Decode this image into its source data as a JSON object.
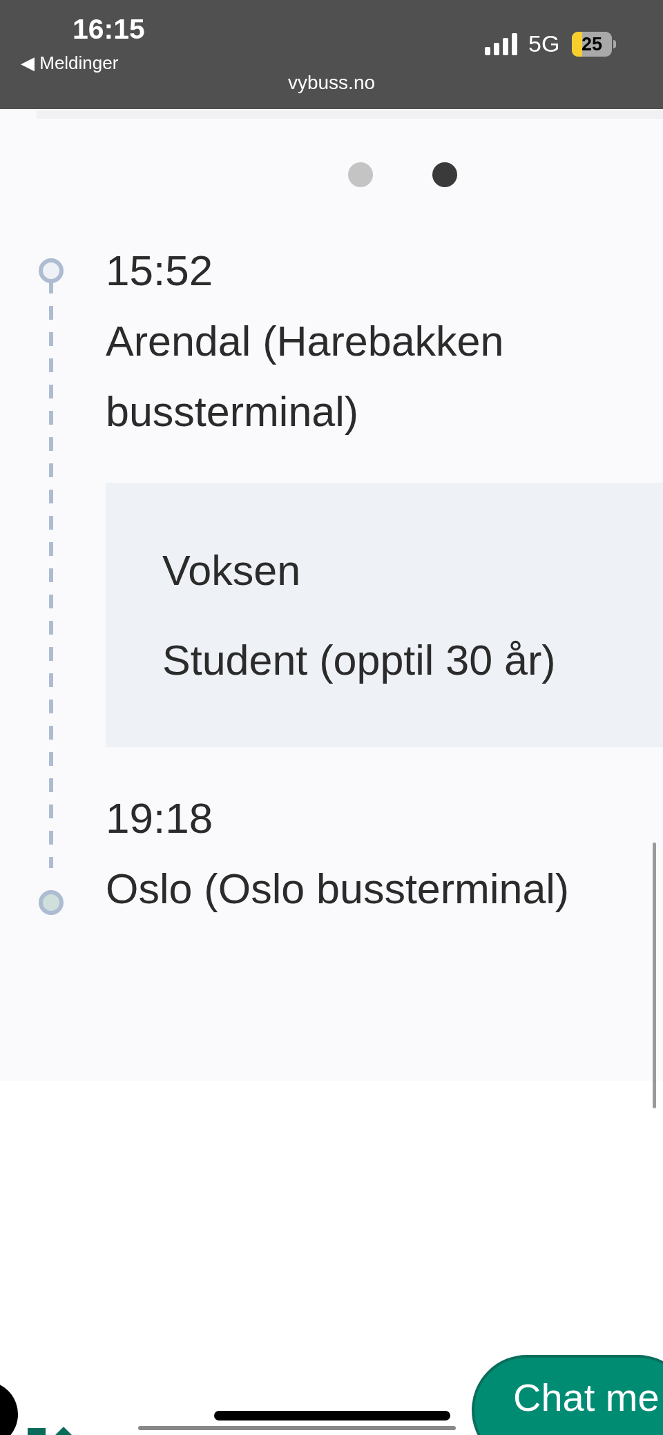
{
  "status_bar": {
    "time": "16:15",
    "back_label": "◀ Meldinger",
    "url": "vybuss.no",
    "network": "5G",
    "battery": "25"
  },
  "carousel": {
    "dots": [
      {
        "selected": false
      },
      {
        "selected": true
      }
    ]
  },
  "trip": {
    "stops": [
      {
        "time": "15:52",
        "name": "Arendal (Harebakken bussterminal)",
        "kind": "start"
      },
      {
        "time": "19:18",
        "name": "Oslo (Oslo bussterminal)",
        "kind": "end"
      }
    ],
    "passengers": [
      "Voksen",
      "Student (opptil 30 år)"
    ]
  },
  "chat_button": {
    "label": "Chat me"
  }
}
